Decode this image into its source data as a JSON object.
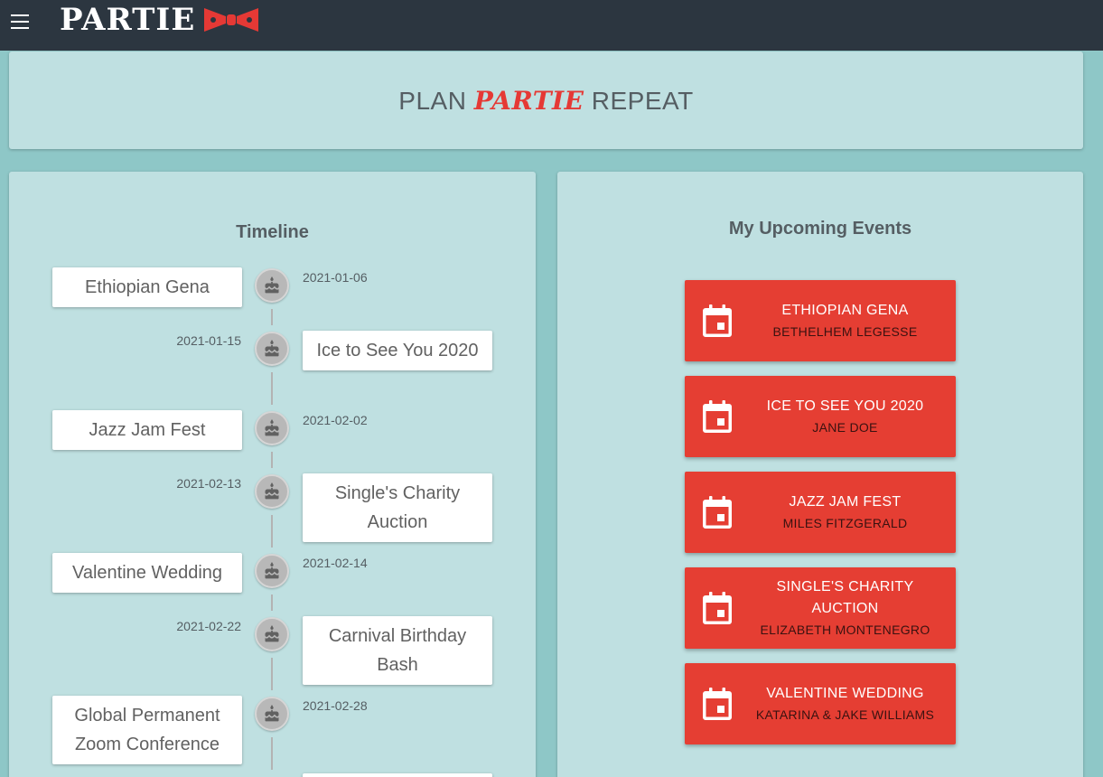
{
  "appbar": {
    "brand": "PARTIE",
    "accent_color": "#e53935",
    "bg_color": "#2c3640"
  },
  "hero": {
    "tagline_start": "PLAN",
    "tagline_accent": "PARTIE",
    "tagline_end": "REPEAT"
  },
  "timeline": {
    "title": "Timeline",
    "items": [
      {
        "name": "Ethiopian Gena",
        "date": "2021-01-06",
        "icon": "cake-icon"
      },
      {
        "name": "Ice to See You 2020",
        "date": "2021-01-15",
        "icon": "cake-icon"
      },
      {
        "name": "Jazz Jam Fest",
        "date": "2021-02-02",
        "icon": "cake-icon"
      },
      {
        "name": "Single's Charity Auction",
        "date": "2021-02-13",
        "icon": "cake-icon"
      },
      {
        "name": "Valentine Wedding",
        "date": "2021-02-14",
        "icon": "cake-icon"
      },
      {
        "name": "Carnival Birthday Bash",
        "date": "2021-02-22",
        "icon": "cake-icon"
      },
      {
        "name": "Global Permanent Zoom Conference",
        "date": "2021-02-28",
        "icon": "cake-icon"
      }
    ]
  },
  "events": {
    "title": "My Upcoming Events",
    "button_color": "#e53e33",
    "items": [
      {
        "title": "ETHIOPIAN GENA",
        "host": "BETHELHEM LEGESSE",
        "icon": "calendar-icon"
      },
      {
        "title": "ICE TO SEE YOU 2020",
        "host": "JANE DOE",
        "icon": "calendar-icon"
      },
      {
        "title": "JAZZ JAM FEST",
        "host": "MILES FITZGERALD",
        "icon": "calendar-icon"
      },
      {
        "title": "SINGLE'S CHARITY AUCTION",
        "host": "ELIZABETH MONTENEGRO",
        "icon": "calendar-icon"
      },
      {
        "title": "VALENTINE WEDDING",
        "host": "KATARINA & JAKE WILLIAMS",
        "icon": "calendar-icon"
      }
    ]
  }
}
